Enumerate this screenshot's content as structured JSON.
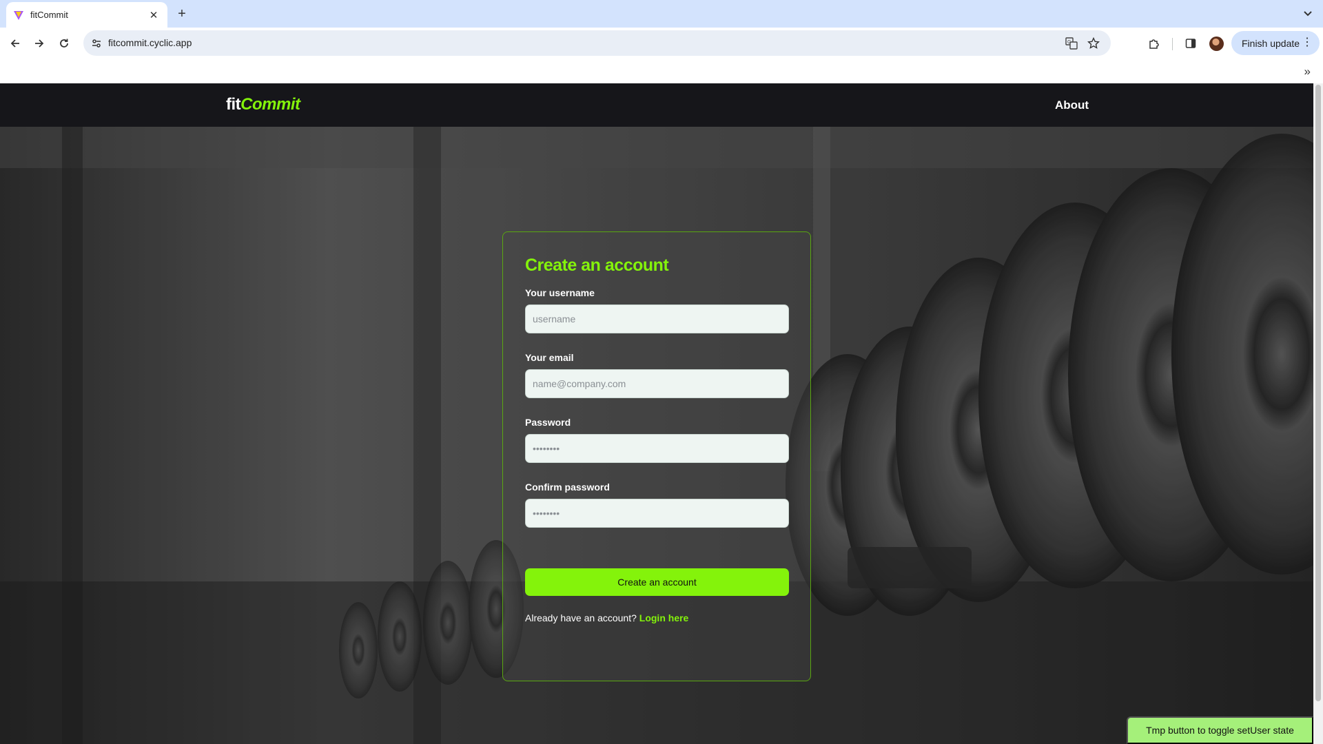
{
  "browser": {
    "tab_title": "fitCommit",
    "url": "fitcommit.cyclic.app",
    "finish_update_label": "Finish update"
  },
  "navbar": {
    "logo_part1": "fit",
    "logo_part2": "Commit",
    "about_label": "About"
  },
  "form": {
    "title": "Create an account",
    "username_label": "Your username",
    "username_placeholder": "username",
    "email_label": "Your email",
    "email_placeholder": "name@company.com",
    "password_label": "Password",
    "password_placeholder": "••••••••",
    "confirm_label": "Confirm password",
    "confirm_placeholder": "••••••••",
    "submit_label": "Create an account",
    "signin_prompt": "Already have an account?",
    "signin_link": "Login here"
  },
  "tmp_button_label": "Tmp button to toggle setUser state",
  "colors": {
    "accent": "#84f30b",
    "navbar_bg": "#16161a",
    "tmp_button_bg": "#a5f07a"
  }
}
